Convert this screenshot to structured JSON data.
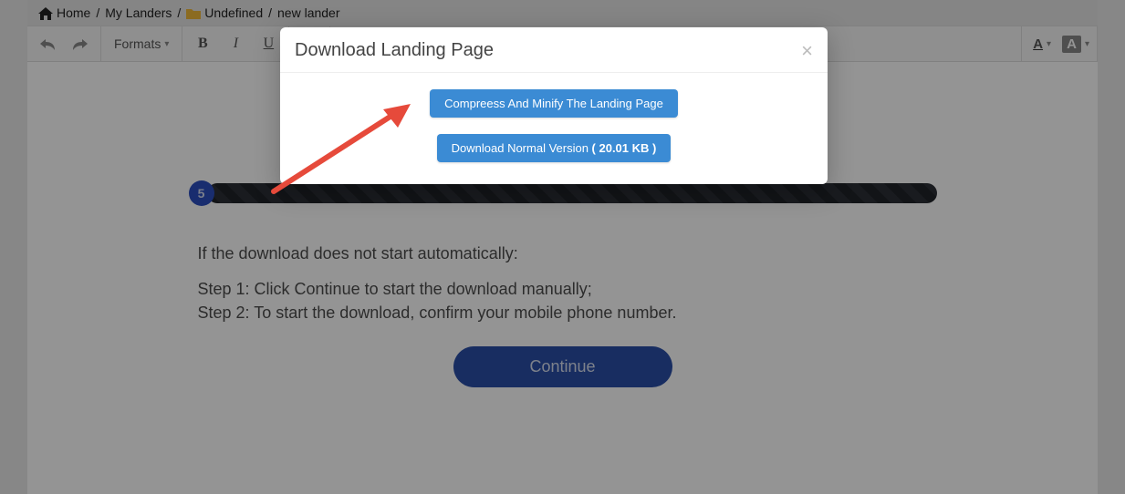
{
  "breadcrumb": {
    "home": "Home",
    "my_landers": "My Landers",
    "undefined_folder": "Undefined",
    "lander_name": "new lander"
  },
  "toolbar": {
    "formats_label": "Formats",
    "bold": "B",
    "italic": "I",
    "underline": "U",
    "fg_color": "A",
    "bg_color": "A"
  },
  "modal": {
    "title": "Download Landing Page",
    "compress_btn": "Compreess And Minify The Landing Page",
    "normal_btn_prefix": "Download Normal Version ",
    "normal_btn_size": "( 20.01 KB )"
  },
  "lander": {
    "step_number": "5",
    "line1": "If the download does not start automatically:",
    "step1": "Step 1: Click Continue to start the download manually;",
    "step2": "Step 2: To start the download, confirm your mobile phone number.",
    "continue": "Continue"
  }
}
